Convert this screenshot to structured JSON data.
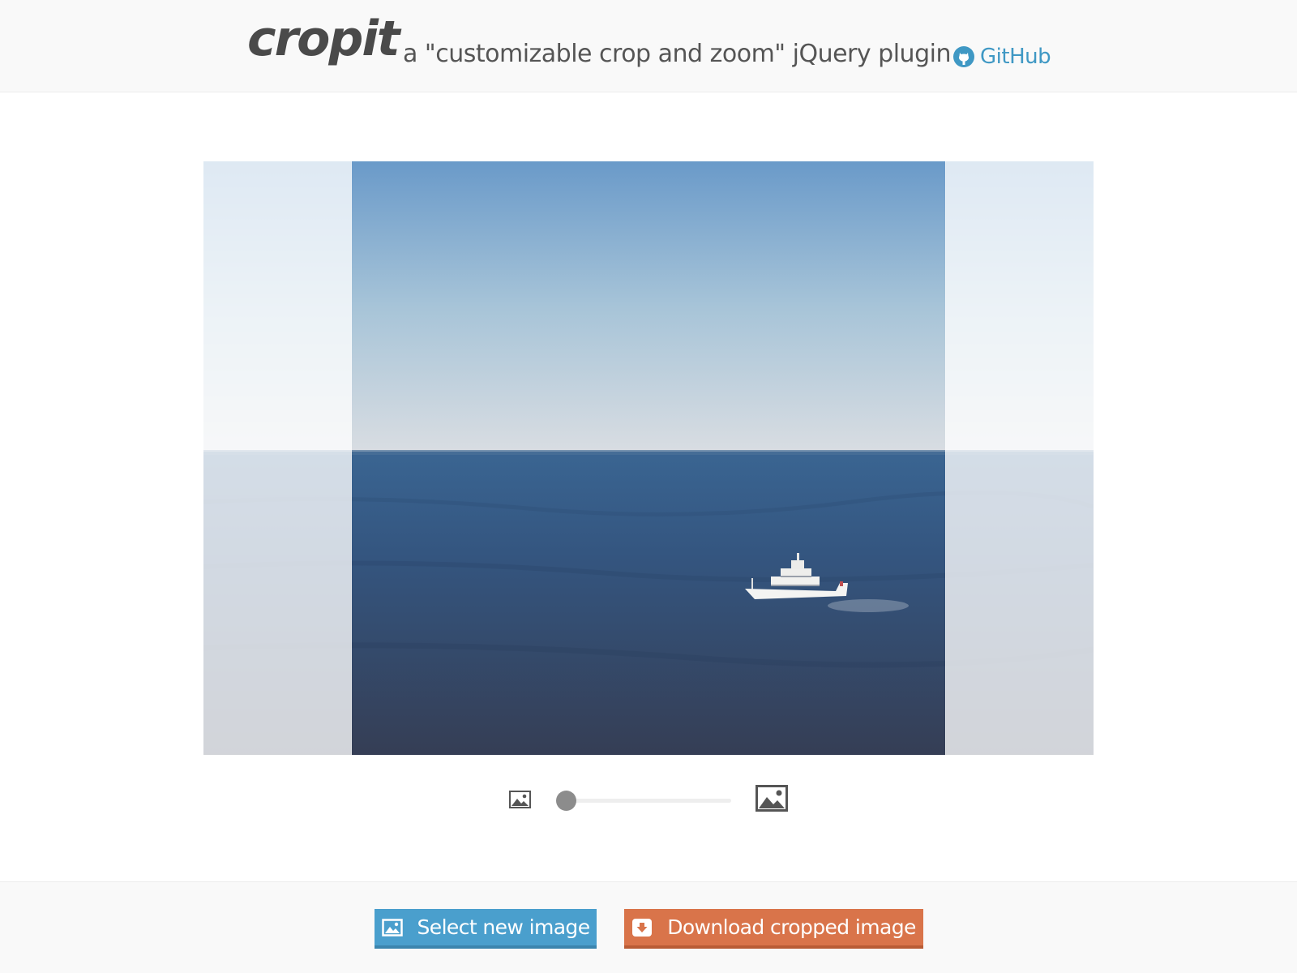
{
  "header": {
    "logo": "cropit",
    "tagline": "a \"customizable crop and zoom\" jQuery plugin",
    "github_label": "GitHub",
    "github_icon": "github-icon",
    "link_color": "#3f98c4"
  },
  "cropper": {
    "image_description": "ocean with white yacht",
    "zoom_level": 0.0,
    "zoom_min_icon": "image-small-icon",
    "zoom_max_icon": "image-large-icon"
  },
  "footer": {
    "select_label": "Select new image",
    "select_icon": "image-icon",
    "select_color": "#4a9fcd",
    "download_label": "Download cropped image",
    "download_icon": "download-icon",
    "download_color": "#d9744a"
  }
}
